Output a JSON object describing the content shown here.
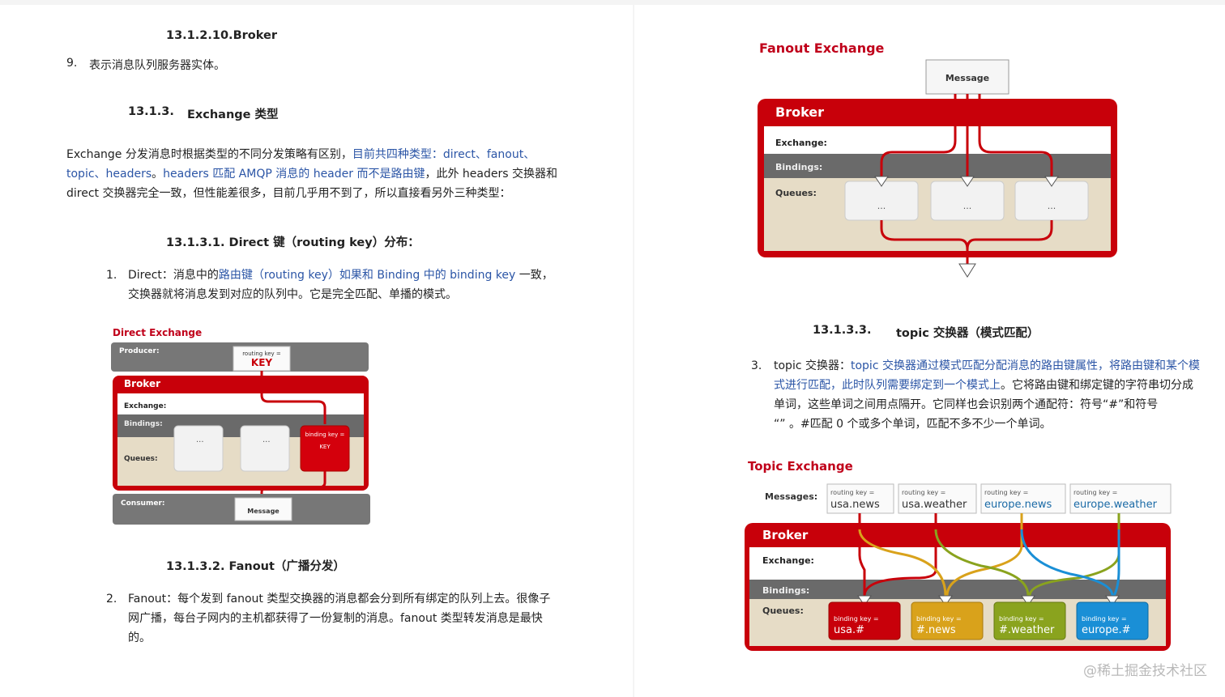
{
  "left": {
    "broker_heading": "13.1.2.10.Broker",
    "broker_item_num": "9.",
    "broker_item_text": "表示消息队列服务器实体。",
    "exchange_heading_num": "13.1.3.",
    "exchange_heading_text": "Exchange 类型",
    "exchange_para": {
      "p1": "Exchange 分发消息时根据类型的不同分发策略有区别，",
      "p2": "目前共四种类型：direct、fanout、",
      "p3": "topic、headers",
      "p4": "。",
      "p5": "headers 匹配 AMQP 消息的 header 而不是路由键",
      "p6": "，此外 headers 交换器和",
      "p7": "direct 交换器完全一致，但性能差很多，目前几乎用不到了，所以直接看另外三种类型："
    },
    "direct_heading": "13.1.3.1.  Direct 键（routing key）分布：",
    "direct_item_num": "1.",
    "direct_item": {
      "p1": "Direct：消息中的",
      "p2": "路由键（routing key）如果和 Binding 中的 binding key",
      "p3": " 一致，",
      "p4": "交换器就将消息发到对应的队列中。它是完全匹配、单播的模式。"
    },
    "direct_diagram": {
      "title": "Direct Exchange",
      "producer": "Producer:",
      "routing_key_label": "routing key =",
      "routing_key_value": "KEY",
      "broker": "Broker",
      "exchange": "Exchange:",
      "bindings": "Bindings:",
      "queues": "Queues:",
      "queue_dots": "...",
      "binding_key_label": "binding key =",
      "binding_key_value": "KEY",
      "consumer": "Consumer:",
      "message": "Message"
    },
    "fanout_heading": "13.1.3.2.  Fanout（广播分发）",
    "fanout_item_num": "2.",
    "fanout_item": {
      "l1": "Fanout：每个发到 fanout 类型交换器的消息都会分到所有绑定的队列上去。很像子",
      "l2": "网广播，每台子网内的主机都获得了一份复制的消息。fanout 类型转发消息是最快",
      "l3": "的。"
    }
  },
  "right": {
    "fanout_diagram": {
      "title": "Fanout Exchange",
      "message": "Message",
      "broker": "Broker",
      "exchange": "Exchange:",
      "bindings": "Bindings:",
      "queues": "Queues:",
      "queue_dots": "..."
    },
    "topic_heading_num": "13.1.3.3.",
    "topic_heading_text": "topic 交换器（模式匹配）",
    "topic_item_num": "3.",
    "topic_item": {
      "p1": "topic 交换器：",
      "p2": "topic 交换器通过模式匹配分配消息的路由键属性，将路由键和某个模",
      "p3": "式进行匹配，此时队列需要绑定到一个模式上",
      "p4": "。它将路由键和绑定键的字符串切分成",
      "l3": "单词，这些单词之间用点隔开。它同样也会识别两个通配符：符号“#”和符号",
      "l4": "“”  。#匹配 0 个或多个单词，匹配不多不少一个单词。"
    },
    "topic_diagram": {
      "title": "Topic Exchange",
      "messages": "Messages:",
      "routing_key_label": "routing key =",
      "routing_keys": [
        "usa.news",
        "usa.weather",
        "europe.news",
        "europe.weather"
      ],
      "broker": "Broker",
      "exchange": "Exchange:",
      "bindings": "Bindings:",
      "queues": "Queues:",
      "binding_key_label": "binding key =",
      "binding_keys": [
        "usa.#",
        "#.news",
        "#.weather",
        "europe.#"
      ],
      "colors": {
        "red": "#c8000a",
        "yellow": "#d9a21b",
        "green": "#8aa31e",
        "blue": "#1a8fd6"
      }
    },
    "watermark": "@稀土掘金技术社区"
  }
}
